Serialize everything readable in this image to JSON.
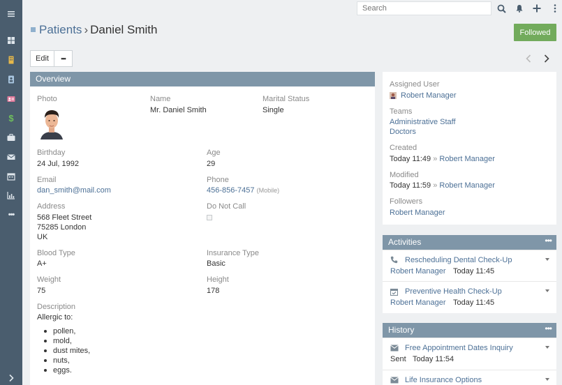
{
  "sidebar": {
    "items": [
      {
        "icon": "menu-icon",
        "label": "Menu"
      },
      {
        "icon": "dashboard-icon",
        "label": "Home"
      },
      {
        "icon": "building-icon",
        "label": "Accounts"
      },
      {
        "icon": "patient-icon",
        "label": "Patients"
      },
      {
        "icon": "contact-card-icon",
        "label": "Contacts"
      },
      {
        "icon": "dollar-icon",
        "label": "Opportunities"
      },
      {
        "icon": "briefcase-icon",
        "label": "Cases"
      },
      {
        "icon": "envelope-icon",
        "label": "Emails"
      },
      {
        "icon": "calendar-icon",
        "label": "Calendar"
      },
      {
        "icon": "chart-icon",
        "label": "Reports"
      },
      {
        "icon": "more-icon",
        "label": "More"
      },
      {
        "icon": "expand-icon",
        "label": "Expand"
      }
    ]
  },
  "topbar": {
    "search_placeholder": "Search"
  },
  "header": {
    "breadcrumb_parent": "Patients",
    "breadcrumb_sep": "›",
    "title": "Daniel Smith",
    "followed_label": "Followed"
  },
  "actions": {
    "edit_label": "Edit",
    "more_label": "•••"
  },
  "overview": {
    "title": "Overview",
    "photo_label": "Photo",
    "name_label": "Name",
    "name_value": "Mr. Daniel Smith",
    "marital_label": "Marital Status",
    "marital_value": "Single",
    "birthday_label": "Birthday",
    "birthday_value": "24 Jul, 1992",
    "age_label": "Age",
    "age_value": "29",
    "email_label": "Email",
    "email_value": "dan_smith@mail.com",
    "phone_label": "Phone",
    "phone_value": "456-856-7457",
    "phone_type": "(Mobile)",
    "address_label": "Address",
    "address_line1": "568 Fleet Street",
    "address_line2": "75285 London",
    "address_line3": "UK",
    "dnc_label": "Do Not Call",
    "blood_label": "Blood Type",
    "blood_value": "A+",
    "insurance_label": "Insurance Type",
    "insurance_value": "Basic",
    "weight_label": "Weight",
    "weight_value": "75",
    "height_label": "Height",
    "height_value": "178",
    "description_label": "Description",
    "description_intro": "Allergic to:",
    "allergies": [
      "pollen,",
      "mold,",
      "dust mites,",
      "nuts,",
      "eggs."
    ]
  },
  "side": {
    "assigned_label": "Assigned User",
    "assigned_value": "Robert Manager",
    "teams_label": "Teams",
    "teams": [
      "Administrative Staff",
      "Doctors"
    ],
    "created_label": "Created",
    "created_time": "Today 11:49",
    "created_by": "Robert Manager",
    "modified_label": "Modified",
    "modified_time": "Today 11:59",
    "modified_by": "Robert Manager",
    "followers_label": "Followers",
    "followers_value": "Robert Manager",
    "arrow": "»"
  },
  "activities": {
    "title": "Activities",
    "items": [
      {
        "icon": "phone-icon",
        "name": "Rescheduling Dental Check-Up",
        "user": "Robert Manager",
        "time": "Today 11:45"
      },
      {
        "icon": "calendar-check-icon",
        "name": "Preventive Health Check-Up",
        "user": "Robert Manager",
        "time": "Today 11:45"
      }
    ]
  },
  "history": {
    "title": "History",
    "items": [
      {
        "icon": "envelope-icon",
        "name": "Free Appointment Dates Inquiry",
        "status": "Sent",
        "time": "Today 11:54"
      },
      {
        "icon": "envelope-icon",
        "name": "Life Insurance Options"
      }
    ]
  },
  "colors": {
    "sidebar": "#4a5d6e",
    "panel_header": "#7f96a8",
    "link": "#4c7096",
    "followed": "#72ab5c",
    "background": "#eef0f2"
  }
}
